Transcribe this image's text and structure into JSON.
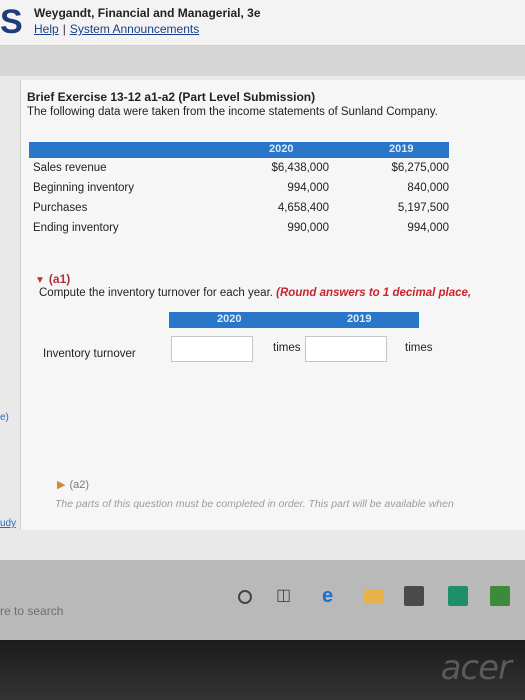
{
  "header": {
    "logo": "S",
    "book_title": "Weygandt, Financial and Managerial, 3e",
    "help_link": "Help",
    "separator": "|",
    "announcements_link": "System Announcements"
  },
  "exercise": {
    "title": "Brief Exercise 13-12 a1-a2 (Part Level Submission)",
    "description": "The following data were taken from the income statements of Sunland Company."
  },
  "data_table": {
    "col_2020": "2020",
    "col_2019": "2019",
    "rows": [
      {
        "label": "Sales revenue",
        "v2020": "$6,438,000",
        "v2019": "$6,275,000"
      },
      {
        "label": "Beginning inventory",
        "v2020": "994,000",
        "v2019": "840,000"
      },
      {
        "label": "Purchases",
        "v2020": "4,658,400",
        "v2019": "5,197,500"
      },
      {
        "label": "Ending inventory",
        "v2020": "990,000",
        "v2019": "994,000"
      }
    ]
  },
  "part_a1": {
    "label": "(a1)",
    "instruction": "Compute the inventory turnover for each year.",
    "instruction_red": "(Round answers to 1 decimal place,",
    "col_2020": "2020",
    "col_2019": "2019",
    "row_label": "Inventory turnover",
    "input_2020": "",
    "input_2019": "",
    "unit": "times"
  },
  "part_a2": {
    "label": "(a2)",
    "note": "The parts of this question must be completed in order. This part will be available when"
  },
  "side": {
    "mark1": "e)",
    "mark2": "udy"
  },
  "taskbar": {
    "search_text": "re to search"
  },
  "bezel": {
    "brand": "acer"
  }
}
